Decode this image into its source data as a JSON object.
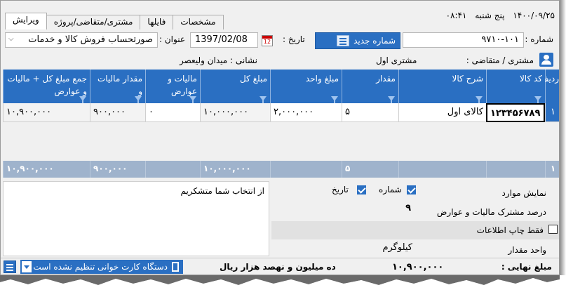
{
  "app": {
    "clock": "۰۸:۴۱",
    "weekday": "پنج شنبه",
    "date_top": "۱۴۰۰/۰۹/۲۵"
  },
  "tabs": [
    {
      "label": "ویرایش",
      "active": true
    },
    {
      "label": "مشتری/متقاضی/پروژه",
      "active": false
    },
    {
      "label": "فایلها",
      "active": false
    },
    {
      "label": "مشخصات",
      "active": false
    }
  ],
  "header": {
    "number_label": "شماره :",
    "number_value": "۹۷۱۰-۱۰۱",
    "new_number_button": "شماره جدید",
    "date_label": "تاریخ :",
    "date_value": "1397/02/08",
    "title_label": "عنوان :",
    "title_value": "صورتحساب فروش کالا و خدمات",
    "customer_label": "مشتری / متقاضی :",
    "customer_value": "مشتری اول",
    "address_label": "نشانی : میدان ولیعصر"
  },
  "grid": {
    "columns": [
      "ردیف",
      "کد کالا",
      "شرح کالا",
      "مقدار",
      "مبلغ واحد",
      "مبلغ کل",
      "مالیات و عوارض",
      "مقدار مالیات و",
      "جمع مبلغ کل + مالیات و عوارض"
    ],
    "rows": [
      {
        "row_no": "۱",
        "code": "۱۲۳۴۵۶۷۸۹",
        "desc": "کالای اول",
        "qty": "۵",
        "unit_price": "۲,۰۰۰,۰۰۰",
        "total": "۱۰,۰۰۰,۰۰۰",
        "tax": "۰",
        "tax_amount": "۹۰۰,۰۰۰",
        "grand": "۱۰,۹۰۰,۰۰۰"
      }
    ],
    "footer": {
      "row_no": "۱",
      "qty": "۵",
      "total": "۱۰,۰۰۰,۰۰۰",
      "tax_amount": "۹۰۰,۰۰۰",
      "grand": "۱۰,۹۰۰,۰۰۰"
    }
  },
  "notes_text": "از انتخاب شما متشکریم",
  "options": {
    "show_items_label": "نمایش موارد",
    "show_number_label": "شماره",
    "show_number_checked": true,
    "show_date_label": "تاریخ",
    "show_date_checked": true,
    "tax_percent_label": "درصد مشترک مالیات و عوارض",
    "tax_percent_value": "۹",
    "print_info_only_label": "فقط چاپ اطلاعات",
    "print_info_only_checked": false,
    "unit_label": "واحد مقدار",
    "unit_value": "کیلوگرم"
  },
  "status": {
    "card_reader_text": "دستگاه کارت خوانی تنظیم نشده است",
    "amount_words": "ده میلیون و نهصد هزار ریال",
    "final_amount": "۱۰,۹۰۰,۰۰۰",
    "final_label": "مبلغ نهایی :"
  },
  "colors": {
    "accent": "#2a6fc2",
    "footer": "#9fb3cc"
  }
}
